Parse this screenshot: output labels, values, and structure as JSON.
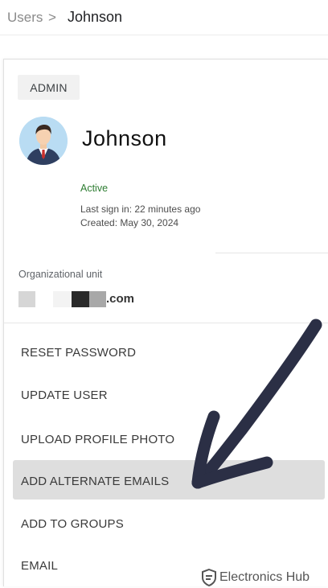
{
  "breadcrumb": {
    "parent": "Users",
    "separator": ">",
    "current": "Johnson"
  },
  "user": {
    "role": "ADMIN",
    "name": "Johnson",
    "status": "Active",
    "last_sign_in": "Last sign in: 22 minutes ago",
    "created": "Created: May 30, 2024"
  },
  "org_unit": {
    "label": "Organizational unit",
    "value_suffix": ".com"
  },
  "menu": {
    "items": [
      {
        "label": "RESET PASSWORD"
      },
      {
        "label": "UPDATE USER"
      },
      {
        "label": "UPLOAD PROFILE PHOTO"
      },
      {
        "label": "ADD ALTERNATE EMAILS",
        "highlighted": true
      },
      {
        "label": "ADD TO GROUPS"
      },
      {
        "label": "EMAIL"
      }
    ]
  },
  "annotation": {
    "arrow_color": "#2b2f45"
  },
  "watermark": {
    "text": "Electronics Hub"
  },
  "colors": {
    "status_green": "#2e7d32",
    "highlight_bg": "#dedede",
    "badge_bg": "#f1f1f1"
  }
}
